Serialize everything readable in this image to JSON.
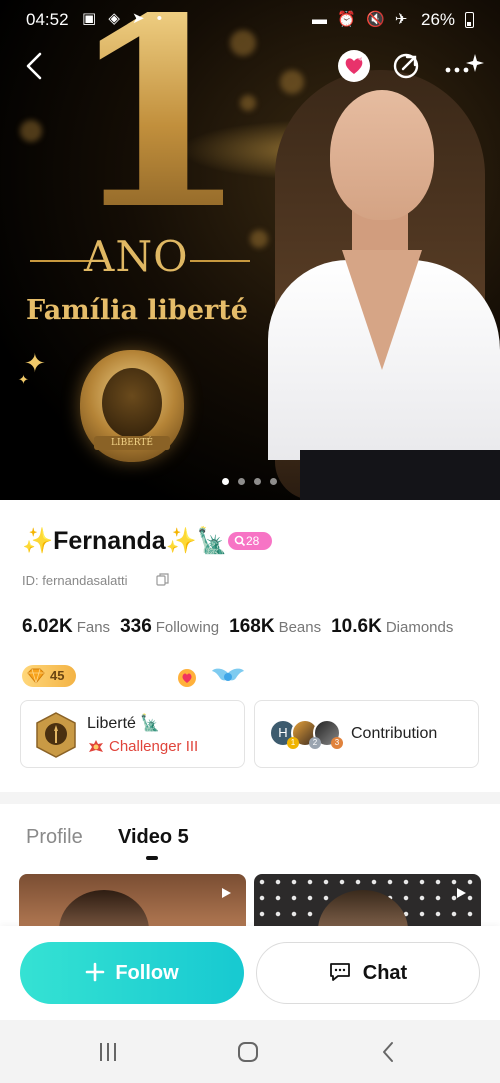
{
  "status_bar": {
    "time": "04:52",
    "left_icons": "▣ ◈ ➤ •",
    "right_icons": "▬ ⏰ 🔇 ✈",
    "battery": "26%"
  },
  "banner": {
    "number": "1",
    "word": "ANO",
    "family_title": "Família liberté",
    "medal_text": "LIBERTÉ"
  },
  "profile": {
    "name": "✨Fernanda✨🗽",
    "level": "28",
    "id_text": "ID: fernandasalatti",
    "stats": [
      {
        "value": "6.02K",
        "label": "Fans"
      },
      {
        "value": "336",
        "label": "Following"
      },
      {
        "value": "168K",
        "label": "Beans"
      },
      {
        "value": "10.6K",
        "label": "Diamonds"
      }
    ],
    "diamond_level": "45"
  },
  "family_card": {
    "name": "Liberté 🗽",
    "rank": "Challenger III"
  },
  "contribution_card": {
    "label": "Contribution",
    "avatar_initial": "H",
    "ranks": [
      "1",
      "2",
      "3"
    ]
  },
  "tabs": [
    {
      "label": "Profile"
    },
    {
      "label": "Video 5"
    }
  ],
  "actions": {
    "follow": "Follow",
    "chat": "Chat"
  },
  "colors": {
    "accent": "#1fd1d2",
    "level_badge": "#f774c5",
    "rank_red": "#e0443b",
    "gold": "#c9a04c"
  }
}
